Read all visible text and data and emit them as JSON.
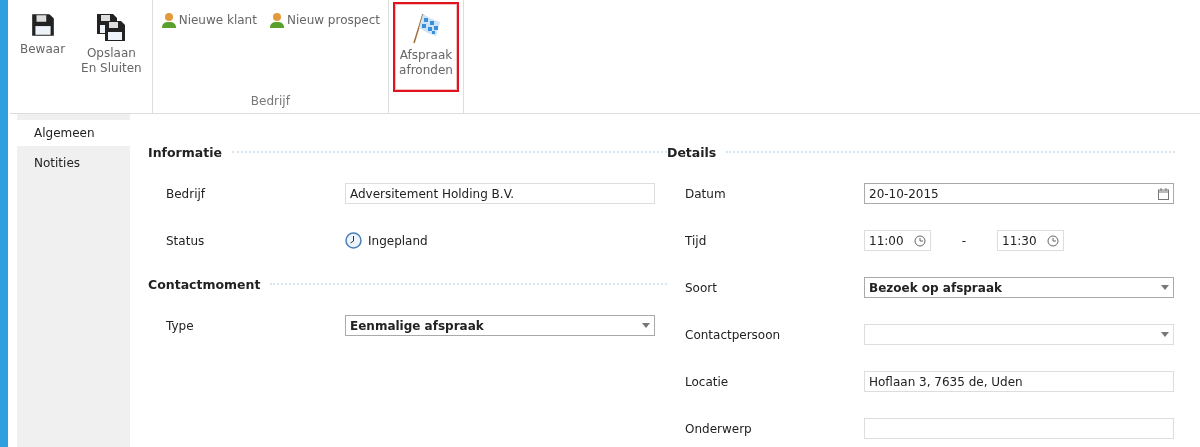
{
  "ribbon": {
    "groups": [
      {
        "buttons": [
          {
            "label": "Bewaar",
            "kind": "large",
            "highlighted": false
          },
          {
            "label": "Opslaan\nEn Sluiten",
            "kind": "large",
            "highlighted": false
          }
        ]
      },
      {
        "label": "Bedrijf",
        "buttons": [
          {
            "label": "Nieuwe klant",
            "kind": "small",
            "highlighted": false
          },
          {
            "label": "Nieuw prospect",
            "kind": "small",
            "highlighted": false
          }
        ]
      },
      {
        "buttons": [
          {
            "label": "Afspraak\nafronden",
            "kind": "large",
            "highlighted": true
          }
        ]
      }
    ]
  },
  "sidebar": {
    "items": [
      {
        "label": "Algemeen",
        "selected": true
      },
      {
        "label": "Notities",
        "selected": false
      }
    ]
  },
  "columns": [
    [
      {
        "title": "Informatie",
        "fields": [
          {
            "label": "Bedrijf",
            "kind": "text",
            "value": "Adversitement Holding B.V."
          },
          {
            "label": "Status",
            "kind": "status",
            "value": "Ingepland"
          }
        ]
      },
      {
        "title": "Contactmoment",
        "fields": [
          {
            "label": "Type",
            "kind": "select",
            "value": "Eenmalige afspraak"
          }
        ]
      }
    ],
    [
      {
        "title": "Details",
        "fields": [
          {
            "label": "Datum",
            "kind": "date",
            "value": "20-10-2015"
          },
          {
            "label": "Tijd",
            "kind": "timerange",
            "from": "11:00",
            "separator": "-",
            "to": "11:30"
          },
          {
            "label": "Soort",
            "kind": "select",
            "value": "Bezoek op afspraak"
          },
          {
            "label": "Contactpersoon",
            "kind": "select"
          },
          {
            "label": "Locatie",
            "kind": "text",
            "value": "Hoflaan 3, 7635 de, Uden"
          },
          {
            "label": "Onderwerp",
            "kind": "text"
          }
        ]
      }
    ]
  ]
}
